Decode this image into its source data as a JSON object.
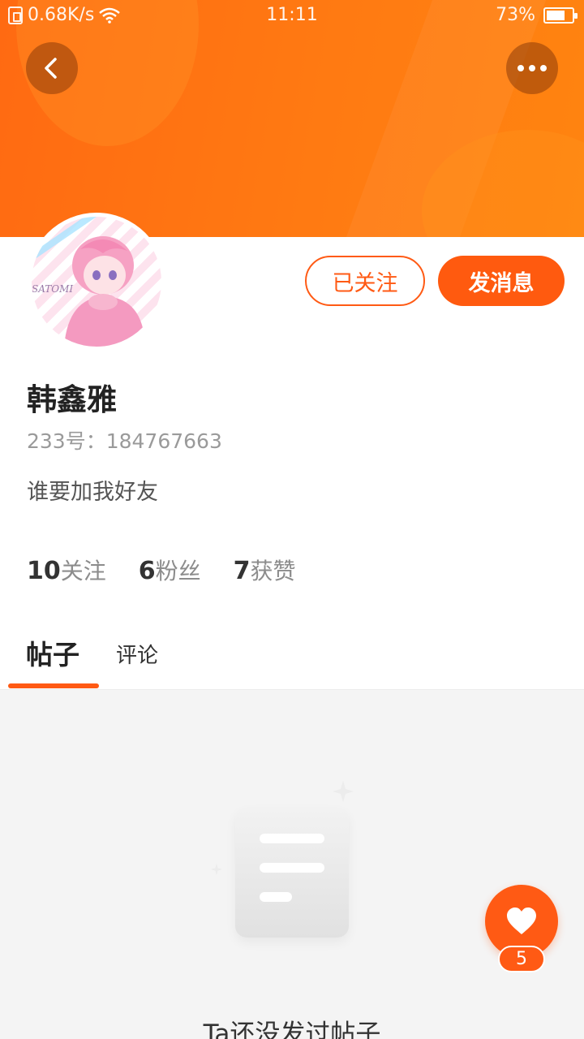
{
  "status_bar": {
    "net_speed": "0.68K/s",
    "time": "11:11",
    "battery": "73%",
    "battery_level": 0.73
  },
  "header": {
    "back_icon": "chevron-left-icon",
    "more_icon": "ellipsis-icon",
    "banner_color": "#ff7a12"
  },
  "profile": {
    "username": "韩鑫雅",
    "uid_label": "233号：184767663",
    "bio": "谁要加我好友",
    "follow_button": "已关注",
    "message_button": "发消息",
    "avatar_text": "SATOMI",
    "stats": [
      {
        "num": "10",
        "label": "关注"
      },
      {
        "num": "6",
        "label": "粉丝"
      },
      {
        "num": "7",
        "label": "获赞"
      }
    ]
  },
  "tabs": {
    "posts": "帖子",
    "comments": "评论"
  },
  "empty_state": {
    "text": "Ta还没发过帖子"
  },
  "like_fab": {
    "count": "5",
    "icon": "heart-icon"
  },
  "colors": {
    "accent": "#ff5a14"
  }
}
